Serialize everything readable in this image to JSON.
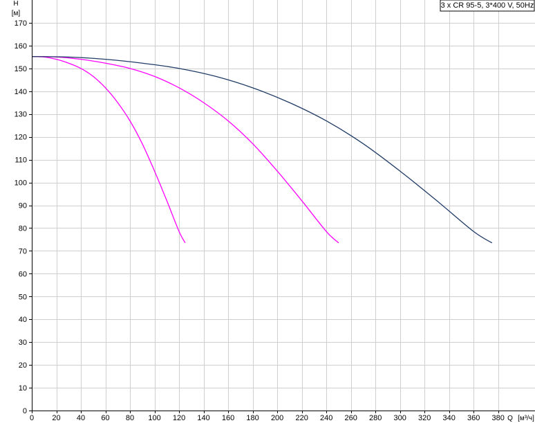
{
  "chart_data": {
    "type": "line",
    "legend_text": "3 x CR 95-5, 3*400 V, 50Hz",
    "legend_position": "top-right",
    "ylabel": "H",
    "yunit": "[м]",
    "xlabel": "Q",
    "xunit": "[м³/ч]",
    "grid": true,
    "xlim": [
      0,
      410
    ],
    "ylim": [
      0,
      180
    ],
    "xticks": [
      0,
      20,
      40,
      60,
      80,
      100,
      120,
      140,
      160,
      180,
      200,
      220,
      240,
      260,
      280,
      300,
      320,
      340,
      360,
      380
    ],
    "yticks": [
      0,
      10,
      20,
      30,
      40,
      50,
      60,
      70,
      80,
      90,
      100,
      110,
      120,
      130,
      140,
      150,
      160,
      170
    ],
    "series": [
      {
        "color": "#ff00ff",
        "points": [
          [
            0,
            155.2
          ],
          [
            10,
            155
          ],
          [
            20,
            154
          ],
          [
            30,
            152.3
          ],
          [
            40,
            150
          ],
          [
            50,
            146.5
          ],
          [
            60,
            141.5
          ],
          [
            70,
            135
          ],
          [
            80,
            127
          ],
          [
            90,
            117
          ],
          [
            100,
            105
          ],
          [
            110,
            92
          ],
          [
            120,
            78.5
          ],
          [
            125,
            73.5
          ]
        ]
      },
      {
        "color": "#ff00ff",
        "points": [
          [
            0,
            155.2
          ],
          [
            20,
            155
          ],
          [
            40,
            154
          ],
          [
            60,
            152.3
          ],
          [
            80,
            150
          ],
          [
            100,
            146.5
          ],
          [
            120,
            141.5
          ],
          [
            140,
            135
          ],
          [
            160,
            127
          ],
          [
            180,
            117
          ],
          [
            200,
            105
          ],
          [
            220,
            92
          ],
          [
            240,
            78.5
          ],
          [
            250,
            73.5
          ]
        ]
      },
      {
        "color": "#1f3b66",
        "points": [
          [
            0,
            155.2
          ],
          [
            30,
            155
          ],
          [
            60,
            154
          ],
          [
            90,
            152.3
          ],
          [
            120,
            150
          ],
          [
            150,
            146.5
          ],
          [
            180,
            141.5
          ],
          [
            210,
            135
          ],
          [
            240,
            127
          ],
          [
            270,
            117
          ],
          [
            300,
            105
          ],
          [
            330,
            92
          ],
          [
            360,
            78.5
          ],
          [
            375,
            73.5
          ]
        ]
      }
    ]
  }
}
